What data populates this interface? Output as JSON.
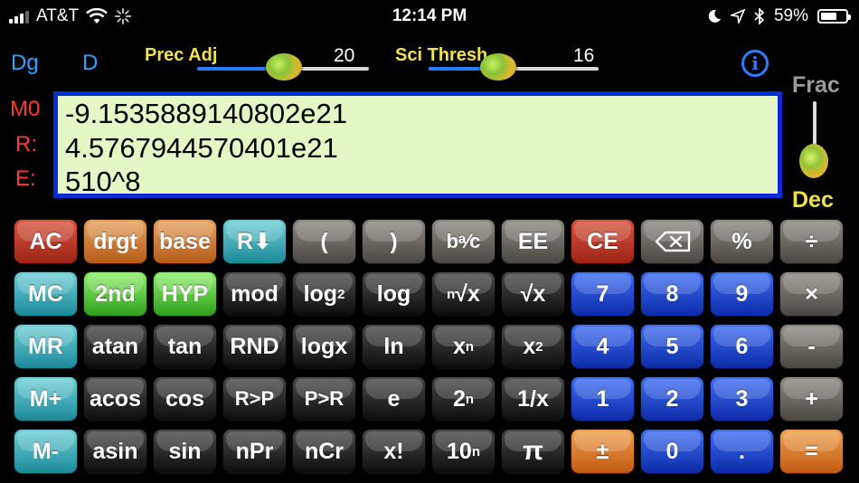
{
  "status_bar": {
    "carrier": "AT&T",
    "time": "12:14 PM",
    "battery": "59%",
    "icons": [
      "signal-bars-icon",
      "wifi-icon",
      "loading-spinner-icon",
      "moon-icon",
      "location-arrow-icon",
      "bluetooth-icon",
      "battery-icon"
    ]
  },
  "mode": {
    "angle": "Dg",
    "display": "D"
  },
  "sliders": {
    "prec": {
      "label": "Prec Adj",
      "value": "20",
      "level": 0.4
    },
    "sci": {
      "label": "Sci Thresh",
      "value": "16",
      "level": 0.4
    }
  },
  "info_button": "i",
  "registers": {
    "m0": "M0",
    "r": "R:",
    "e": "E:"
  },
  "display": {
    "memory": "-9.1535889140802e21",
    "result": "4.5767944570401e21",
    "expression": "510^8"
  },
  "frac_dec": {
    "frac": "Frac",
    "dec": "Dec"
  },
  "colors": {
    "display_bg": "#e4f7c5",
    "display_border": "#0a2bd6",
    "register_red": "#ff3a30",
    "mode_blue": "#2fa3ff",
    "label_yellow": "#f2e24a"
  },
  "keys": {
    "row1": {
      "ac": "AC",
      "drgt": "drgt",
      "base": "base",
      "rdown": "R⬇",
      "lparen": "(",
      "rparen": ")",
      "bac": "bᵃ⁄c",
      "ee": "EE",
      "ce": "CE",
      "backspace": "⌫",
      "percent": "%",
      "divide": "÷"
    },
    "row2": {
      "mc": "MC",
      "second": "2nd",
      "hyp": "HYP",
      "mod": "mod",
      "log2": "log",
      "log2_sub": "2",
      "log": "log",
      "nroot_n": "n",
      "nroot": "√x",
      "sqrt": "√x",
      "seven": "7",
      "eight": "8",
      "nine": "9",
      "multiply": "×"
    },
    "row3": {
      "mr": "MR",
      "atan": "atan",
      "tan": "tan",
      "rnd": "RND",
      "logx": "logx",
      "ln": "ln",
      "xn": "x",
      "xn_sup": "n",
      "x2": "x",
      "x2_sup": "2",
      "four": "4",
      "five": "5",
      "six": "6",
      "minus": "-"
    },
    "row4": {
      "mplus": "M+",
      "acos": "acos",
      "cos": "cos",
      "rp": "R>P",
      "pr": "P>R",
      "e": "e",
      "twon": "2",
      "twon_sup": "n",
      "recip": "1/x",
      "one": "1",
      "two": "2",
      "three": "3",
      "plus": "+"
    },
    "row5": {
      "mminus": "M-",
      "asin": "asin",
      "sin": "sin",
      "npr": "nPr",
      "ncr": "nCr",
      "fact": "x!",
      "tenn": "10",
      "tenn_sup": "n",
      "pi": "π",
      "plusminus": "±",
      "zero": "0",
      "dot": ".",
      "equals": "="
    }
  }
}
